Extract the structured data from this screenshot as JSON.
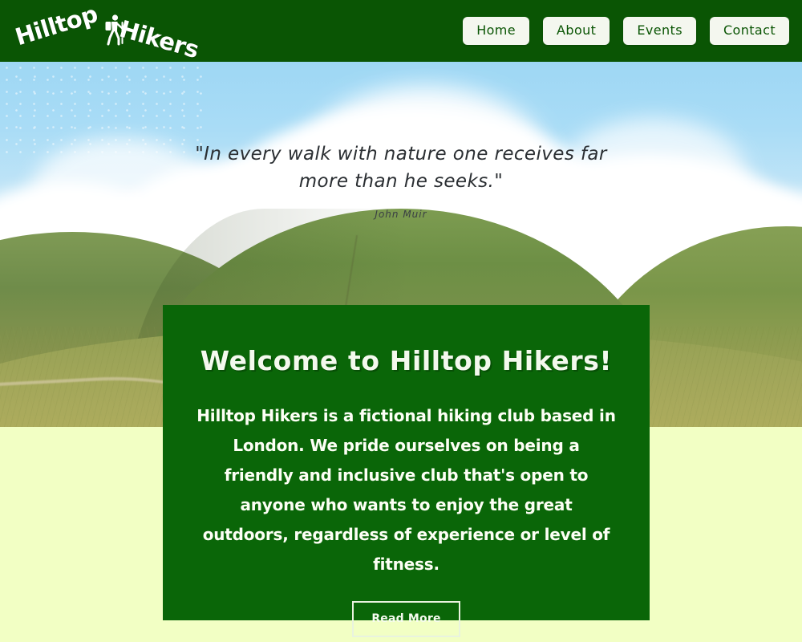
{
  "colors": {
    "header_green": "#0a5504",
    "card_green": "#0a6608",
    "page_background": "#f2ffc4",
    "nav_button_background": "#f4f7ef",
    "nav_button_text": "#0a5504",
    "sky_blue": "#a8dcf5",
    "text_white": "#fdfff5"
  },
  "header": {
    "logo": {
      "word_left": "Hilltop",
      "word_right": "Hikers",
      "icon": "hiker-icon"
    },
    "nav": {
      "items": [
        {
          "label": "Home",
          "name": "nav-item-home"
        },
        {
          "label": "About",
          "name": "nav-item-about"
        },
        {
          "label": "Events",
          "name": "nav-item-events"
        },
        {
          "label": "Contact",
          "name": "nav-item-contact"
        }
      ]
    }
  },
  "hero": {
    "image_description": "rolling green hills under a blue sky with large white clouds, a dirt trail and a small hiker on the left",
    "quote": {
      "text": "\"In every walk with nature one receives far more than he seeks.\"",
      "author": "John Muir"
    }
  },
  "welcome": {
    "title": "Welcome to Hilltop Hikers!",
    "body": "Hilltop Hikers is a fictional hiking club based in London. We pride ourselves on being a friendly and inclusive club that's open to anyone who wants to enjoy the great outdoors, regardless of experience or level of fitness.",
    "cta_label": "Read More"
  }
}
